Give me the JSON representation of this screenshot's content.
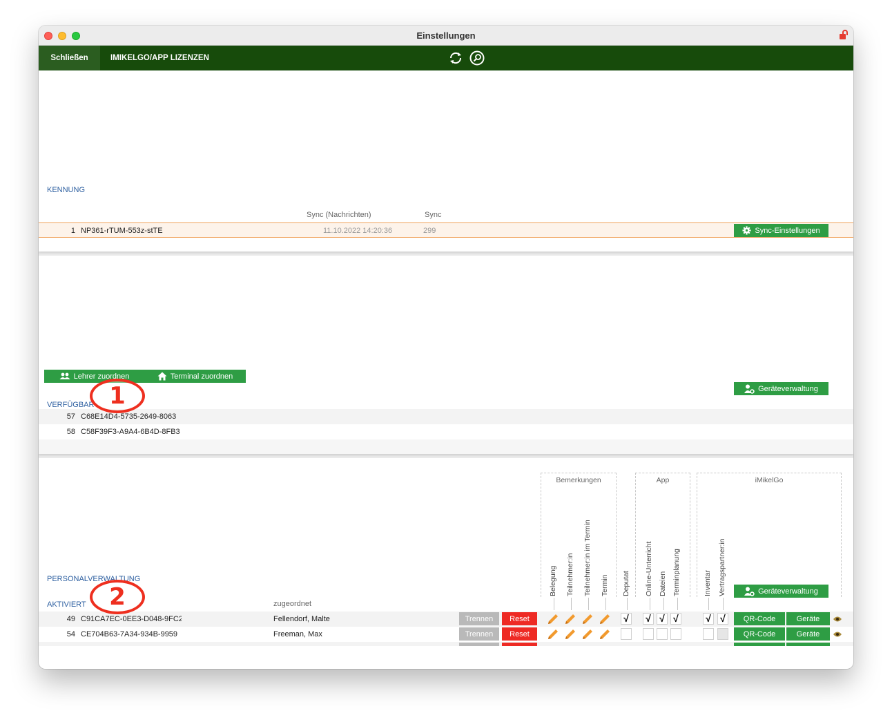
{
  "window": {
    "title": "Einstellungen"
  },
  "toolbar": {
    "close_label": "Schließen",
    "licenses_label": "IMIKELGO/APP LIZENZEN"
  },
  "kennung": {
    "section_label": "KENNUNG",
    "col_sync_messages": "Sync (Nachrichten)",
    "col_sync": "Sync",
    "row": {
      "num": "1",
      "id": "NP361-rTUM-553z-stTE",
      "sync_messages": "11.10.2022 14:20:36",
      "sync": "299"
    },
    "sync_button": "Sync-Einstellungen"
  },
  "verfuegbar": {
    "assign_teacher_button": "Lehrer zuordnen",
    "assign_terminal_button": "Terminal zuordnen",
    "device_management_button": "Geräteverwaltung",
    "section_label": "VERFÜGBAR",
    "rows": [
      {
        "num": "57",
        "id": "C68E14D4-5735-2649-8063"
      },
      {
        "num": "58",
        "id": "C58F39F3-A9A4-6B4D-8FB3"
      }
    ]
  },
  "personal": {
    "section_label": "PERSONALVERWALTUNG",
    "activated_label": "AKTIVIERT",
    "col_assigned": "zugeordnet",
    "device_management_button": "Geräteverwaltung",
    "groups": {
      "bemerkungen": "Bemerkungen",
      "app": "App",
      "imikelgo": "iMikelGo"
    },
    "columns": {
      "belegung": "Belegung",
      "teilnehmer": "Teilnehmer:in",
      "teilnehmer_termin": "Teilnehmer:in im Termin",
      "termin": "Termin",
      "deputat": "Deputat",
      "online_unterricht": "Online-Unterricht",
      "dateien": "Dateien",
      "terminplanung": "Terminplanung",
      "inventar": "Inventar",
      "vertragspartner": "Vertragspartner:in"
    },
    "rows": [
      {
        "num": "49",
        "id": "C91CA7EC-0EE3-D048-9FC2",
        "assigned": "Fellendorf, Malte",
        "trennen": "Trennen",
        "reset": "Reset",
        "qr": "QR-Code",
        "devices": "Geräte",
        "deputat": "√",
        "online": "√",
        "dateien": "√",
        "terminplanung": "√",
        "inventar": "√",
        "vertragspartner": "√"
      },
      {
        "num": "54",
        "id": "CE704B63-7A34-934B-9959",
        "assigned": "Freeman, Max",
        "trennen": "Trennen",
        "reset": "Reset",
        "qr": "QR-Code",
        "devices": "Geräte",
        "deputat": "",
        "online": "",
        "dateien": "",
        "terminplanung": "",
        "inventar": "",
        "vertragspartner": ""
      }
    ]
  },
  "annotations": {
    "badge_1": "1",
    "badge_2": "2"
  },
  "colors": {
    "toolbar_bg": "#174b0b",
    "accent_green": "#2e9d44",
    "reset_red": "#ee2a24",
    "label_blue": "#2d5fa0",
    "pencil_orange": "#f29a2e",
    "annotation_red": "#ee2f1f"
  }
}
